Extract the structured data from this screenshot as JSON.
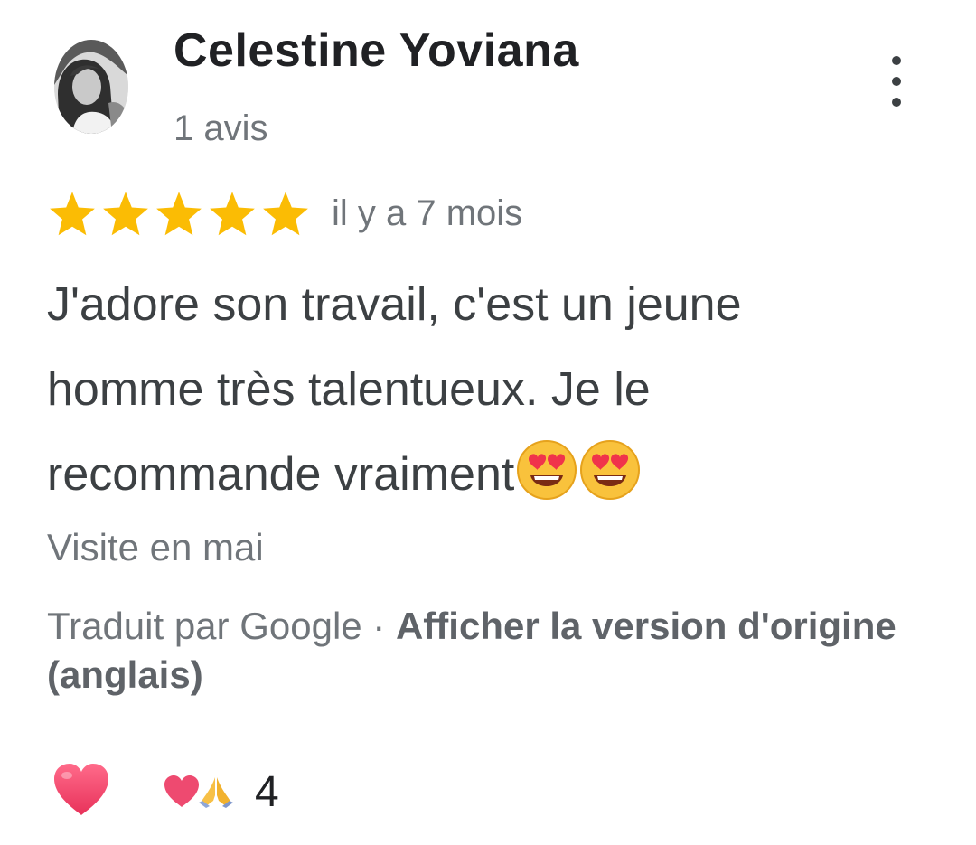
{
  "review": {
    "author": {
      "name": "Celestine Yoviana",
      "review_count": "1 avis",
      "avatar_icon": "profile-photo"
    },
    "menu_icon": "more-vert-icon",
    "rating": {
      "stars": 5,
      "max_stars": 5,
      "star_color": "#fbbc04",
      "date": "il y a 7 mois"
    },
    "text": {
      "line1": "J'adore son travail, c'est un jeune",
      "line2": "homme très talentueux. Je le",
      "line3": "recommande vraiment",
      "emojis": [
        "heart-eyes-emoji",
        "heart-eyes-emoji"
      ]
    },
    "visit": "Visite en mai",
    "translation": {
      "prefix": "Traduit par Google · ",
      "link": "Afficher la version d'origine (anglais)"
    },
    "reactions": {
      "like_icon": "heart-icon",
      "like_color": "#ea4c6e",
      "summary_icons": [
        "heart-icon",
        "praying-hands-icon"
      ],
      "count": "4"
    }
  }
}
